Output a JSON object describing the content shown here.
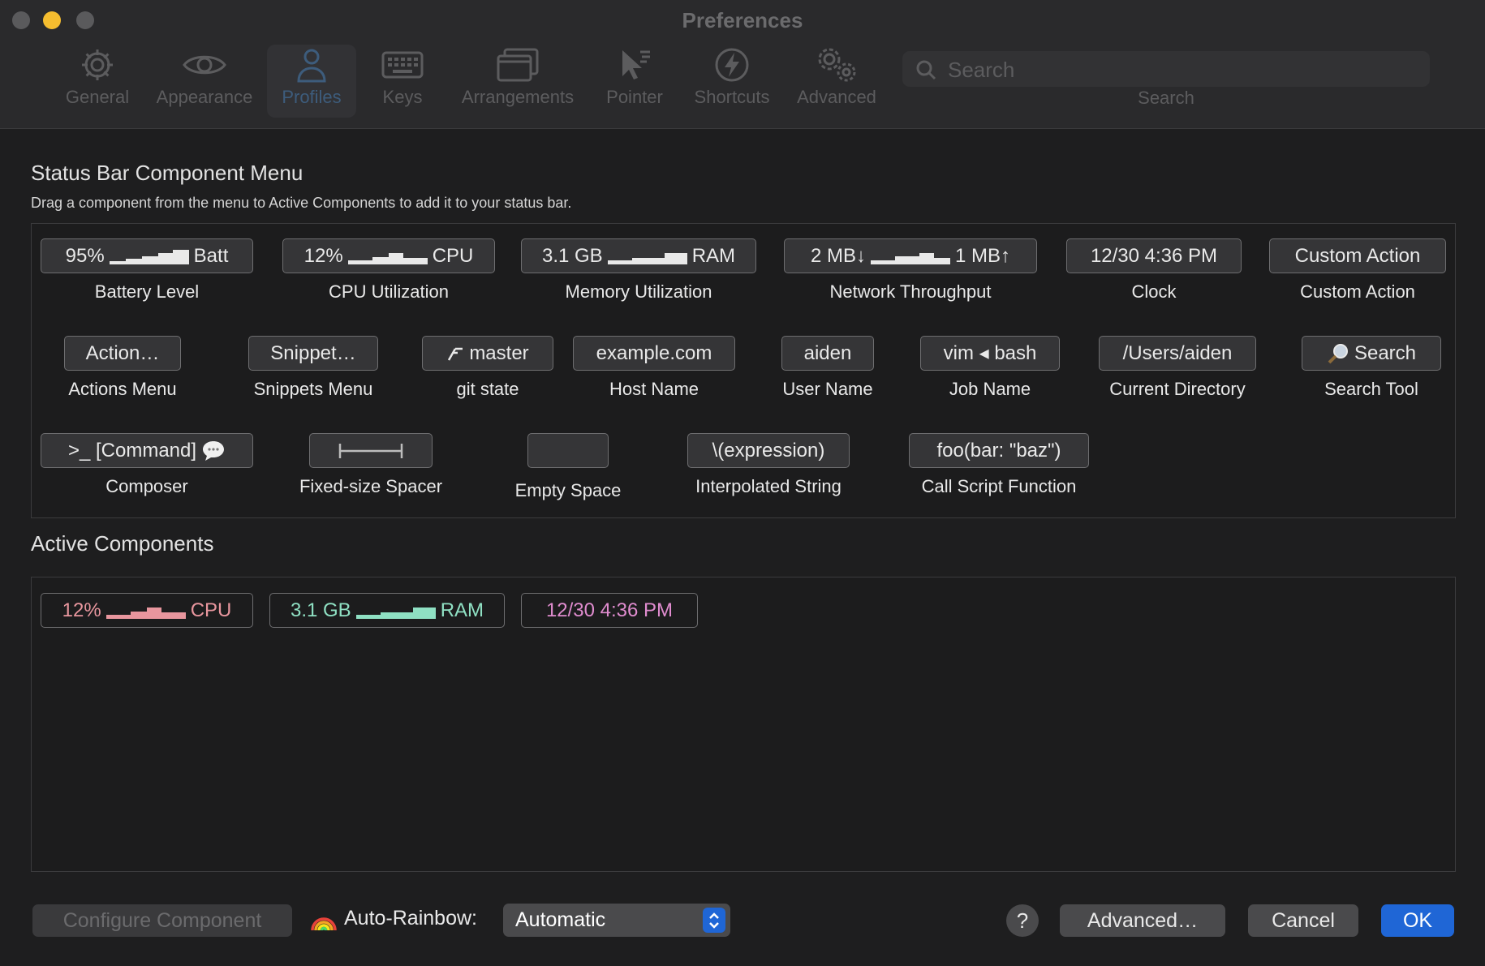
{
  "window": {
    "title": "Preferences"
  },
  "toolbar": {
    "items": [
      {
        "label": "General",
        "icon": "gear-icon"
      },
      {
        "label": "Appearance",
        "icon": "eye-icon"
      },
      {
        "label": "Profiles",
        "icon": "person-icon",
        "selected": true
      },
      {
        "label": "Keys",
        "icon": "keyboard-icon"
      },
      {
        "label": "Arrangements",
        "icon": "window-stack-icon"
      },
      {
        "label": "Pointer",
        "icon": "cursor-icon"
      },
      {
        "label": "Shortcuts",
        "icon": "lightning-icon"
      },
      {
        "label": "Advanced",
        "icon": "gears-icon"
      }
    ],
    "search": {
      "placeholder": "Search",
      "label": "Search"
    }
  },
  "menu": {
    "title": "Status Bar Component Menu",
    "description": "Drag a component from the menu to Active Components to add it to your status bar.",
    "components": [
      {
        "chip_left": "95%",
        "chip_right": "Batt",
        "label": "Battery Level"
      },
      {
        "chip_left": "12%",
        "chip_right": "CPU",
        "label": "CPU Utilization"
      },
      {
        "chip_left": "3.1 GB",
        "chip_right": "RAM",
        "label": "Memory Utilization"
      },
      {
        "chip_left": "2 MB↓",
        "chip_right": "1 MB↑",
        "label": "Network Throughput"
      },
      {
        "chip": "12/30 4:36 PM",
        "label": "Clock"
      },
      {
        "chip": "Custom Action",
        "label": "Custom Action"
      },
      {
        "chip": "Action…",
        "label": "Actions Menu"
      },
      {
        "chip": "Snippet…",
        "label": "Snippets Menu"
      },
      {
        "chip": "master",
        "label": "git state"
      },
      {
        "chip": "example.com",
        "label": "Host Name"
      },
      {
        "chip": "aiden",
        "label": "User Name"
      },
      {
        "chip": "vim ◂ bash",
        "label": "Job Name"
      },
      {
        "chip": "/Users/aiden",
        "label": "Current Directory"
      },
      {
        "chip": "Search",
        "label": "Search Tool"
      },
      {
        "chip": ">_ [Command]",
        "label": "Composer"
      },
      {
        "chip": "",
        "label": "Fixed-size Spacer"
      },
      {
        "chip": "",
        "label": "Empty Space"
      },
      {
        "chip": "\\(expression)",
        "label": "Interpolated String"
      },
      {
        "chip": "foo(bar: \"baz\")",
        "label": "Call Script Function"
      }
    ]
  },
  "active": {
    "title": "Active Components",
    "components": [
      {
        "left": "12%",
        "right": "CPU",
        "color": "#e8969e"
      },
      {
        "left": "3.1 GB",
        "right": "RAM",
        "color": "#8fe0c3"
      },
      {
        "text": "12/30 4:36 PM",
        "color": "#e08ccf"
      }
    ]
  },
  "footer": {
    "configure_label": "Configure Component",
    "rainbow_label": "Auto-Rainbow:",
    "rainbow_value": "Automatic",
    "help_label": "?",
    "advanced_label": "Advanced…",
    "cancel_label": "Cancel",
    "ok_label": "OK"
  },
  "colors": {
    "accent": "#1f66d6",
    "minimize": "#f5bd2f"
  }
}
